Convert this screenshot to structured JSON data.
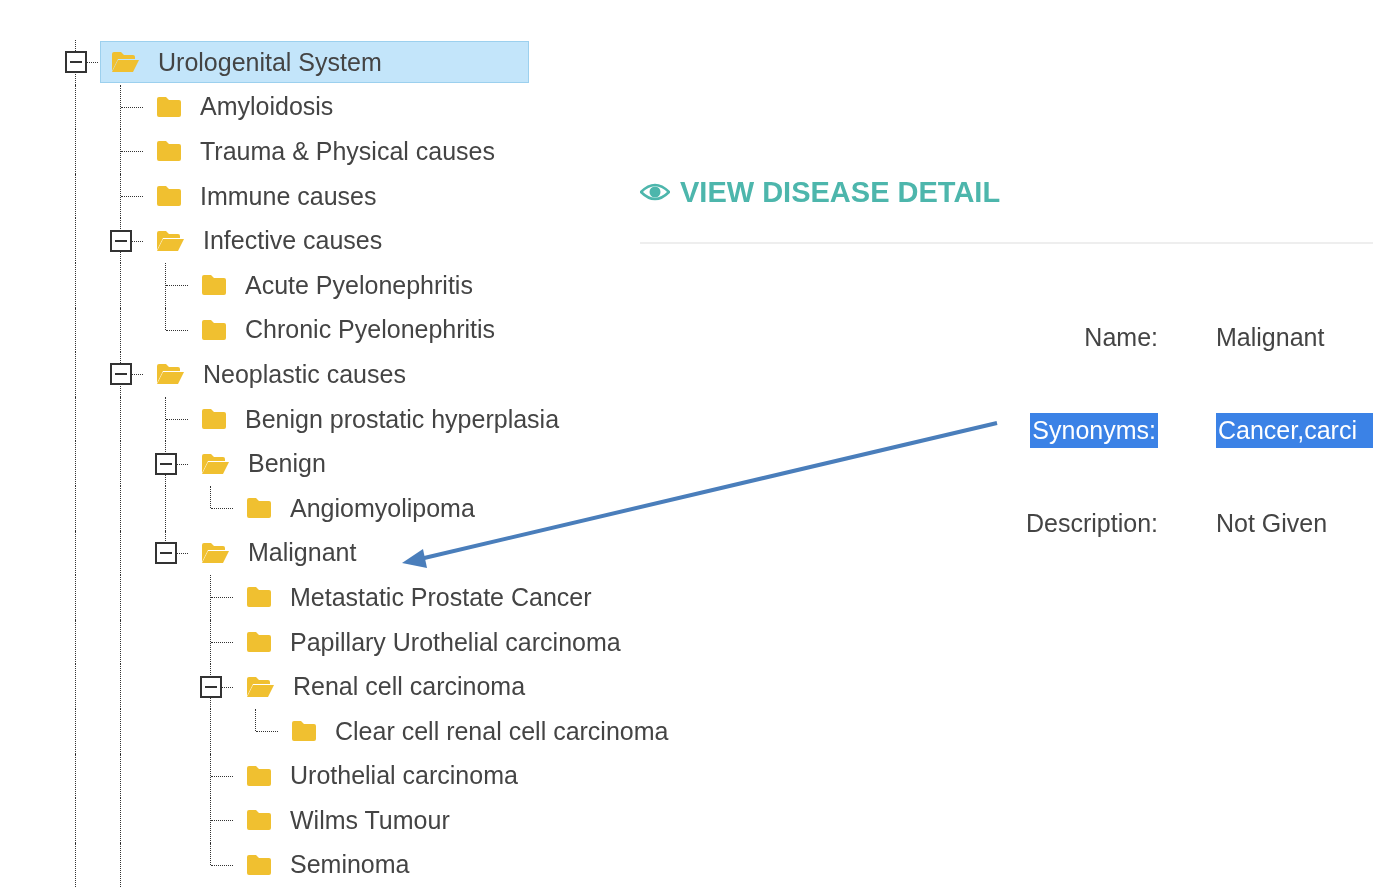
{
  "tree": [
    {
      "label": "Urologenital System",
      "selected": true,
      "expanded": true,
      "children": [
        {
          "label": "Amyloidosis",
          "selected": false
        },
        {
          "label": "Trauma & Physical causes",
          "selected": false
        },
        {
          "label": "Immune causes",
          "selected": false
        },
        {
          "label": "Infective causes",
          "selected": false,
          "expanded": true,
          "children": [
            {
              "label": "Acute Pyelonephritis",
              "selected": false
            },
            {
              "label": "Chronic Pyelonephritis",
              "selected": false
            }
          ]
        },
        {
          "label": "Neoplastic causes",
          "selected": false,
          "expanded": true,
          "children": [
            {
              "label": "Benign prostatic hyperplasia",
              "selected": false
            },
            {
              "label": "Benign",
              "selected": false,
              "expanded": true,
              "children": [
                {
                  "label": "Angiomyolipoma",
                  "selected": false
                }
              ]
            },
            {
              "label": "Malignant",
              "selected": false,
              "expanded": true,
              "children": [
                {
                  "label": "Metastatic Prostate Cancer",
                  "selected": false
                },
                {
                  "label": "Papillary Urothelial carcinoma",
                  "selected": false
                },
                {
                  "label": "Renal cell carcinoma",
                  "selected": false,
                  "expanded": true,
                  "children": [
                    {
                      "label": "Clear cell renal cell carcinoma",
                      "selected": false
                    }
                  ]
                },
                {
                  "label": "Urothelial carcinoma",
                  "selected": false
                },
                {
                  "label": "Wilms Tumour",
                  "selected": false
                },
                {
                  "label": "Seminoma",
                  "selected": false
                }
              ]
            }
          ]
        }
      ]
    }
  ],
  "detail": {
    "title": "VIEW DISEASE DETAIL",
    "fields": [
      {
        "label": "Name:",
        "value": "Malignant",
        "selected": false
      },
      {
        "label": "Synonyms:",
        "value": "Cancer,carci",
        "selected": true
      },
      {
        "label": "Description:",
        "value": "Not Given",
        "selected": false
      }
    ]
  }
}
